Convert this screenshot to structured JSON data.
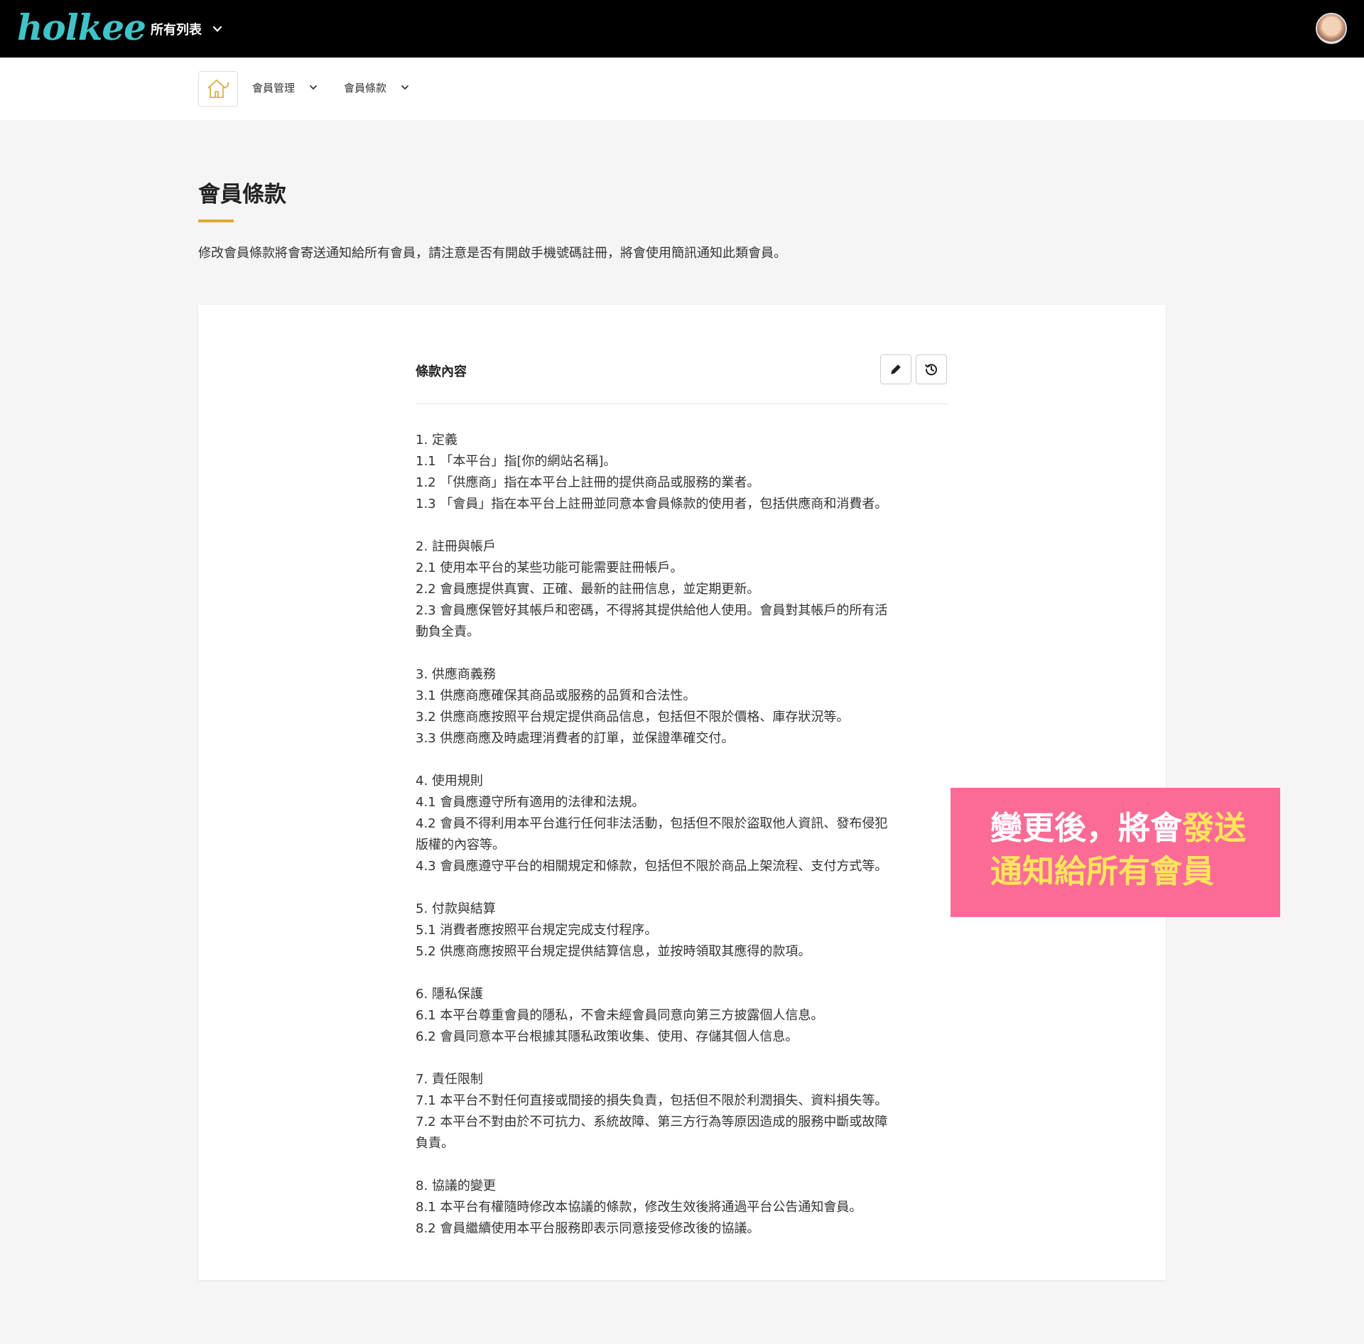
{
  "topbar": {
    "logo": "holkee",
    "list_menu_label": "所有列表"
  },
  "breadcrumb": {
    "items": [
      "會員管理",
      "會員條款"
    ]
  },
  "page": {
    "title": "會員條款",
    "description": "修改會員條款將會寄送通知給所有會員，請注意是否有開啟手機號碼註冊，將會使用簡訊通知此類會員。"
  },
  "card": {
    "content_label": "條款內容",
    "sections": [
      [
        "1. 定義",
        "1.1 「本平台」指[你的網站名稱]。",
        "1.2 「供應商」指在本平台上註冊的提供商品或服務的業者。",
        "1.3 「會員」指在本平台上註冊並同意本會員條款的使用者，包括供應商和消費者。"
      ],
      [
        "2. 註冊與帳戶",
        "2.1 使用本平台的某些功能可能需要註冊帳戶。",
        "2.2 會員應提供真實、正確、最新的註冊信息，並定期更新。",
        "2.3 會員應保管好其帳戶和密碼，不得將其提供給他人使用。會員對其帳戶的所有活",
        "動負全責。"
      ],
      [
        "3. 供應商義務",
        "3.1 供應商應確保其商品或服務的品質和合法性。",
        "3.2 供應商應按照平台規定提供商品信息，包括但不限於價格、庫存狀況等。",
        "3.3 供應商應及時處理消費者的訂單，並保證準確交付。"
      ],
      [
        "4. 使用規則",
        "4.1 會員應遵守所有適用的法律和法規。",
        "4.2 會員不得利用本平台進行任何非法活動，包括但不限於盜取他人資訊、發布侵犯",
        "版權的內容等。",
        "4.3 會員應遵守平台的相關規定和條款，包括但不限於商品上架流程、支付方式等。"
      ],
      [
        "5. 付款與結算",
        "5.1 消費者應按照平台規定完成支付程序。",
        "5.2 供應商應按照平台規定提供結算信息，並按時領取其應得的款項。"
      ],
      [
        "6. 隱私保護",
        "6.1 本平台尊重會員的隱私，不會未經會員同意向第三方披露個人信息。",
        "6.2 會員同意本平台根據其隱私政策收集、使用、存儲其個人信息。"
      ],
      [
        "7. 責任限制",
        "7.1 本平台不對任何直接或間接的損失負責，包括但不限於利潤損失、資料損失等。",
        "7.2 本平台不對由於不可抗力、系統故障、第三方行為等原因造成的服務中斷或故障",
        "負責。"
      ],
      [
        "8. 協議的變更",
        "8.1 本平台有權隨時修改本協議的條款，修改生效後將通過平台公告通知會員。",
        "8.2 會員繼續使用本平台服務即表示同意接受修改後的協議。"
      ]
    ]
  },
  "callout": {
    "line1_white": "變更後，將會",
    "line1_yellow": "發送",
    "line2_yellow": "通知給所有會員"
  },
  "colors": {
    "logo": "#3ec4c8",
    "accent_bar": "#e0a82e",
    "callout_bg": "#fb6b96",
    "callout_highlight": "#ffe45c"
  },
  "icons": [
    "home-icon",
    "chevron-down-icon",
    "pencil-icon",
    "history-icon",
    "avatar"
  ]
}
